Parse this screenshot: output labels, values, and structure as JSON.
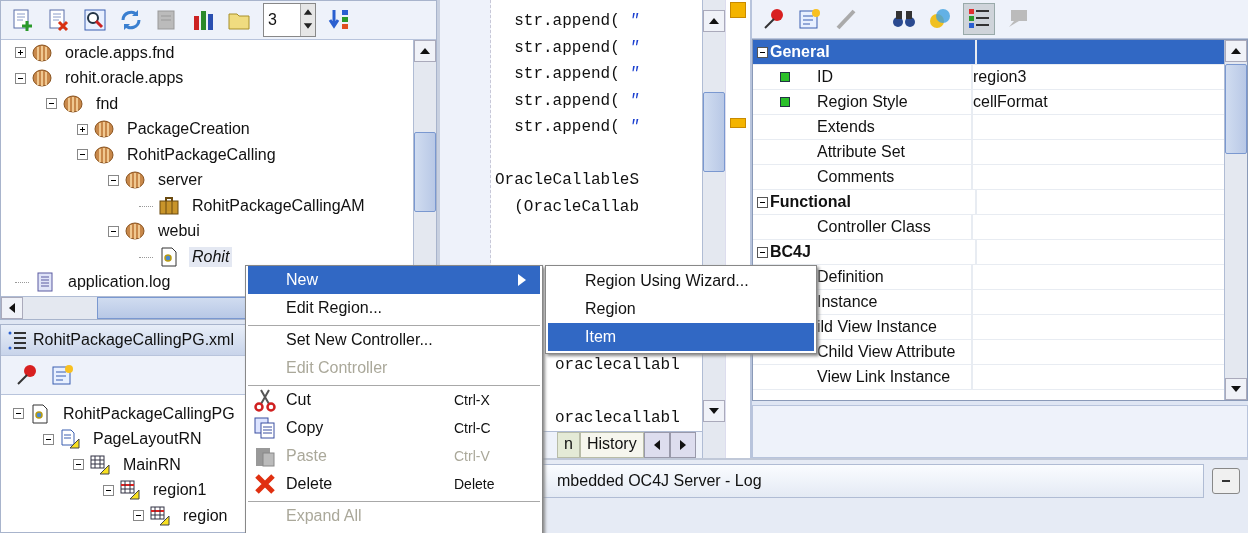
{
  "navigator": {
    "depth_field": {
      "value": "3"
    },
    "tree": [
      {
        "label": "oracle.apps.fnd",
        "kind": "package",
        "expanded": false,
        "selected": false
      },
      {
        "label": "rohit.oracle.apps",
        "kind": "package",
        "expanded": true,
        "selected": false,
        "children": [
          {
            "label": "fnd",
            "kind": "package",
            "expanded": true,
            "selected": false,
            "children": [
              {
                "label": "PackageCreation",
                "kind": "package",
                "expanded": false,
                "selected": false
              },
              {
                "label": "RohitPackageCalling",
                "kind": "package",
                "expanded": true,
                "selected": false,
                "children": [
                  {
                    "label": "server",
                    "kind": "package",
                    "expanded": true,
                    "selected": false,
                    "children": [
                      {
                        "label": "RohitPackageCallingAM",
                        "kind": "am",
                        "selected": false
                      }
                    ]
                  },
                  {
                    "label": "webui",
                    "kind": "package",
                    "expanded": true,
                    "selected": false,
                    "children": [
                      {
                        "label": "Rohit",
                        "kind": "page",
                        "selected": true
                      }
                    ]
                  }
                ]
              }
            ]
          }
        ]
      },
      {
        "label": "application.log",
        "kind": "log",
        "selected": false
      }
    ]
  },
  "structure": {
    "tab": "RohitPackageCallingPG.xml",
    "tree": [
      {
        "label": "RohitPackageCallingPG",
        "kind": "page",
        "expanded": true,
        "selected": false,
        "children": [
          {
            "label": "PageLayoutRN",
            "kind": "layout",
            "expanded": true,
            "selected": false,
            "children": [
              {
                "label": "MainRN",
                "kind": "grid",
                "expanded": true,
                "selected": false,
                "children": [
                  {
                    "label": "region1",
                    "kind": "table",
                    "expanded": true,
                    "selected": false,
                    "children": [
                      {
                        "label": "region",
                        "kind": "table",
                        "expanded": true,
                        "selected": false
                      }
                    ]
                  }
                ]
              }
            ]
          }
        ]
      }
    ]
  },
  "editor": {
    "lines": [
      {
        "code": "  str.append( ",
        "string": "\""
      },
      {
        "code": "  str.append( ",
        "string": "\""
      },
      {
        "code": "  str.append( ",
        "string": "\""
      },
      {
        "code": "  str.append( ",
        "string": "\""
      },
      {
        "code": "  str.append( ",
        "string": "\""
      },
      {
        "code": "OracleCallableS",
        "blank_before": true
      },
      {
        "code": "  (OracleCallab",
        "blank_before": false
      }
    ],
    "lower_lines": [
      {
        "code": "oraclecallabl",
        "blank_before": false
      },
      {
        "code": "oraclecallabl",
        "blank_before": true
      }
    ],
    "tabs": [
      {
        "label": "n",
        "selected": false
      },
      {
        "label": "History",
        "selected": true
      }
    ]
  },
  "log": {
    "tab": "mbedded OC4J Server - Log"
  },
  "properties": {
    "groups": [
      {
        "name": "General",
        "selected": true,
        "expanded": true,
        "rows": [
          {
            "name": "ID",
            "value": "region3",
            "marked": true
          },
          {
            "name": "Region Style",
            "value": "cellFormat",
            "marked": true
          },
          {
            "name": "Extends",
            "marked": false
          },
          {
            "name": "Attribute Set",
            "marked": false
          },
          {
            "name": "Comments",
            "marked": false
          }
        ]
      },
      {
        "name": "Functional",
        "selected": false,
        "expanded": true,
        "rows": [
          {
            "name": "Controller Class",
            "marked": false
          }
        ]
      },
      {
        "name": "BC4J",
        "selected": false,
        "expanded": true,
        "rows": [
          {
            "name": "Definition",
            "marked": false
          },
          {
            "name": "Instance",
            "marked": false
          },
          {
            "name": "ild View Instance",
            "marked": false
          },
          {
            "name": "Child View Attribute",
            "marked": false
          },
          {
            "name": "View Link Instance",
            "marked": false
          }
        ]
      }
    ]
  },
  "context_menu": {
    "items": [
      {
        "label": "New",
        "selected": true,
        "disabled": false,
        "submenu": true,
        "separator_before": false
      },
      {
        "label": "Edit Region...",
        "selected": false,
        "disabled": false,
        "submenu": false,
        "separator_before": false
      },
      {
        "label": "Set New Controller...",
        "selected": false,
        "disabled": false,
        "submenu": false,
        "separator_before": true
      },
      {
        "label": "Edit Controller",
        "selected": false,
        "disabled": true,
        "submenu": false,
        "separator_before": false
      },
      {
        "label": "Cut",
        "shortcut": "Ctrl-X",
        "kind": "cut",
        "selected": false,
        "disabled": false,
        "submenu": false,
        "separator_before": true
      },
      {
        "label": "Copy",
        "shortcut": "Ctrl-C",
        "kind": "copy",
        "selected": false,
        "disabled": false,
        "submenu": false,
        "separator_before": false
      },
      {
        "label": "Paste",
        "shortcut": "Ctrl-V",
        "kind": "paste",
        "selected": false,
        "disabled": true,
        "submenu": false,
        "separator_before": false
      },
      {
        "label": "Delete",
        "shortcut": "Delete",
        "kind": "delete",
        "selected": false,
        "disabled": false,
        "submenu": false,
        "separator_before": false
      },
      {
        "label": "Expand All",
        "selected": false,
        "disabled": true,
        "submenu": false,
        "separator_before": true
      }
    ]
  },
  "submenu": {
    "items": [
      {
        "label": "Region Using Wizard...",
        "selected": false
      },
      {
        "label": "Region",
        "selected": false
      },
      {
        "label": "Item",
        "selected": true
      }
    ]
  }
}
